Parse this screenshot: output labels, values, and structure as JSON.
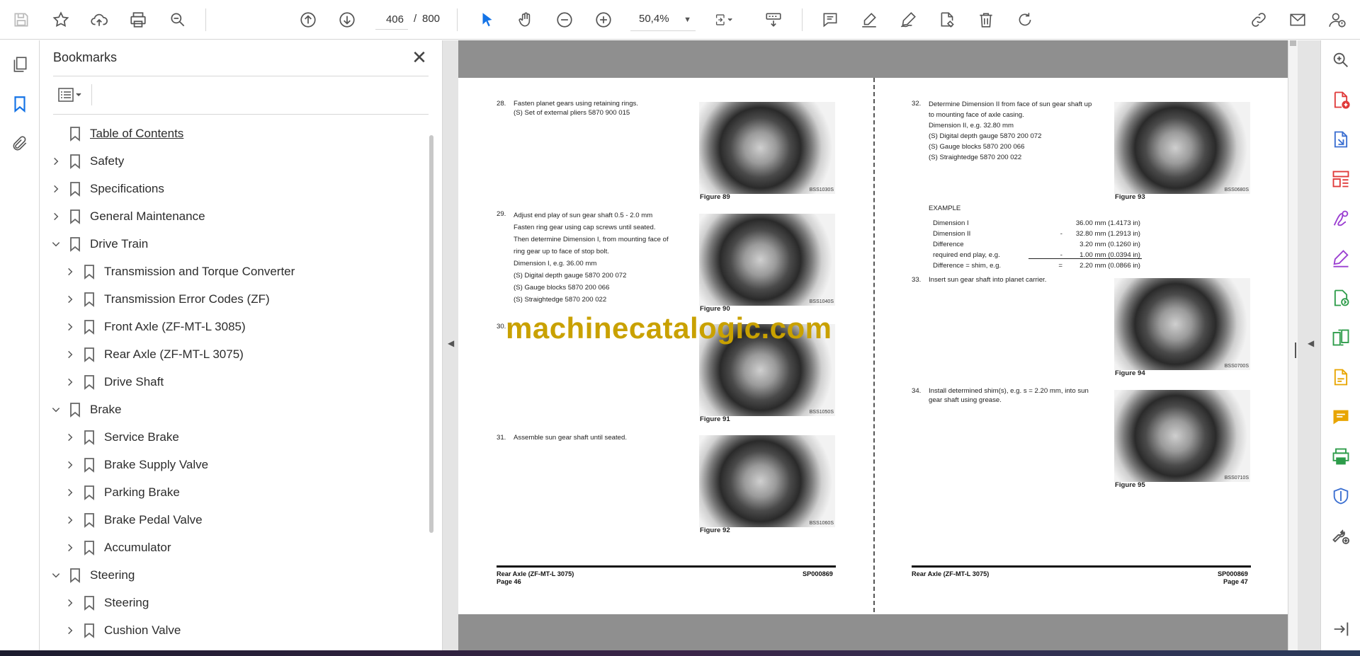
{
  "toolbar": {
    "page_current": "406",
    "page_separator": "/",
    "page_total": "800",
    "zoom": "50,4%"
  },
  "bookmarks": {
    "title": "Bookmarks",
    "items": [
      {
        "label": "Table of Contents",
        "level": 0,
        "state": "none"
      },
      {
        "label": "Safety",
        "level": 0,
        "state": "collapsed"
      },
      {
        "label": "Specifications",
        "level": 0,
        "state": "collapsed"
      },
      {
        "label": "General Maintenance",
        "level": 0,
        "state": "collapsed"
      },
      {
        "label": "Drive Train",
        "level": 0,
        "state": "expanded"
      },
      {
        "label": "Transmission and Torque Converter",
        "level": 1,
        "state": "collapsed"
      },
      {
        "label": "Transmission Error Codes (ZF)",
        "level": 1,
        "state": "collapsed"
      },
      {
        "label": "Front Axle (ZF-MT-L 3085)",
        "level": 1,
        "state": "collapsed"
      },
      {
        "label": "Rear Axle (ZF-MT-L 3075)",
        "level": 1,
        "state": "collapsed"
      },
      {
        "label": "Drive Shaft",
        "level": 1,
        "state": "collapsed"
      },
      {
        "label": "Brake",
        "level": 0,
        "state": "expanded"
      },
      {
        "label": "Service Brake",
        "level": 1,
        "state": "collapsed"
      },
      {
        "label": "Brake Supply Valve",
        "level": 1,
        "state": "collapsed"
      },
      {
        "label": "Parking Brake",
        "level": 1,
        "state": "collapsed"
      },
      {
        "label": "Brake Pedal Valve",
        "level": 1,
        "state": "collapsed"
      },
      {
        "label": "Accumulator",
        "level": 1,
        "state": "collapsed"
      },
      {
        "label": "Steering",
        "level": 0,
        "state": "expanded"
      },
      {
        "label": "Steering",
        "level": 1,
        "state": "collapsed"
      },
      {
        "label": "Cushion Valve",
        "level": 1,
        "state": "collapsed"
      }
    ]
  },
  "document": {
    "left_page": {
      "steps": [
        {
          "num": "28.",
          "text": "Fasten planet gears using retaining rings.\n(S) Set of external pliers 5870 900 015"
        },
        {
          "num": "29.",
          "text": "Adjust end play of sun gear shaft 0.5 - 2.0 mm\nFasten ring gear using cap screws until seated.\nThen determine Dimension I, from mounting face of\nring gear up to face of stop bolt.\nDimension I, e.g. 36.00 mm\n(S) Digital depth gauge 5870 200 072\n(S) Gauge blocks 5870 200 066\n(S) Straightedge 5870 200 022"
        },
        {
          "num": "30.",
          "text": ""
        },
        {
          "num": "31.",
          "text": "Assemble sun gear shaft until seated."
        }
      ],
      "figures": [
        {
          "caption": "Figure 89",
          "code": "BSS1030S"
        },
        {
          "caption": "Figure 90",
          "code": "BSS1040S"
        },
        {
          "caption": "Figure 91",
          "code": "BSS1050S"
        },
        {
          "caption": "Figure 92",
          "code": "BSS1060S"
        }
      ],
      "footer_title": "Rear Axle (ZF-MT-L 3075)",
      "footer_page": "Page 46",
      "footer_code": "SP000869"
    },
    "right_page": {
      "steps": [
        {
          "num": "32.",
          "text": "Determine Dimension II from face of sun gear shaft up\nto mounting face of axle casing.\nDimension II, e.g. 32.80 mm\n(S) Digital depth gauge 5870 200 072\n(S) Gauge blocks 5870 200 066\n(S) Straightedge 5870 200 022"
        },
        {
          "num": "33.",
          "text": "Insert sun gear shaft into planet carrier."
        },
        {
          "num": "34.",
          "text": "Install determined shim(s), e.g. s = 2.20 mm, into sun\ngear shaft using grease."
        }
      ],
      "example_heading": "EXAMPLE",
      "example_rows": [
        {
          "label": "Dimension I",
          "op": "",
          "value": "36.00 mm (1.4173 in)"
        },
        {
          "label": "Dimension II",
          "op": "-",
          "value": "32.80 mm (1.2913 in)"
        },
        {
          "label": "Difference",
          "op": "",
          "value": "3.20 mm (0.1260 in)"
        },
        {
          "label": "required end play, e.g.",
          "op": "-",
          "value": "1.00 mm (0.0394 in)"
        },
        {
          "label": "Difference = shim, e.g.",
          "op": "=",
          "value": "2.20 mm (0.0866 in)"
        }
      ],
      "figures": [
        {
          "caption": "Figure 93",
          "code": "BSS0680S"
        },
        {
          "caption": "Figure 94",
          "code": "BSS0700S"
        },
        {
          "caption": "Figure 95",
          "code": "BSS0710S"
        }
      ],
      "footer_title": "Rear Axle (ZF-MT-L 3075)",
      "footer_page": "Page 47",
      "footer_code": "SP000869"
    },
    "watermark": "machinecatalogic.com"
  },
  "colors": {
    "accent": "#1473e6",
    "watermark": "#c9a100",
    "pdf_red": "#e03a3a",
    "purple": "#9b3fd1",
    "green": "#2d9c4a",
    "yellow": "#e8a500",
    "blue_shield": "#3b6fd1"
  }
}
